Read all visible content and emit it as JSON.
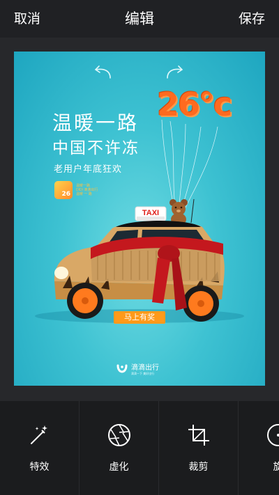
{
  "header": {
    "cancel": "取消",
    "title": "编辑",
    "save": "保存"
  },
  "poster": {
    "temperature": "26°c",
    "headline_line1": "温暖一路",
    "headline_line2": "中国不许冻",
    "subtitle": "老用户年底狂欢",
    "app_tile_value": "26",
    "tile_line1": "温暖一路",
    "tile_line2": "DIDI 滴滴出行",
    "tile_line3": "温暖 一 路",
    "taxi_sign": "TAXI",
    "cta_button": "马上有奖",
    "brand_name": "滴滴出行",
    "brand_tagline": "滴滴一下 美好出行",
    "colors": {
      "sky": "#3ec2d2",
      "balloon": "#ff6a1f",
      "cta": "#ff9a1a",
      "scarf": "#c4181e"
    }
  },
  "toolbar": {
    "items": [
      {
        "label": "特效",
        "icon": "magic-wand-icon"
      },
      {
        "label": "虚化",
        "icon": "aperture-icon"
      },
      {
        "label": "裁剪",
        "icon": "crop-icon"
      },
      {
        "label": "旋",
        "icon": "rotate-icon"
      }
    ]
  }
}
